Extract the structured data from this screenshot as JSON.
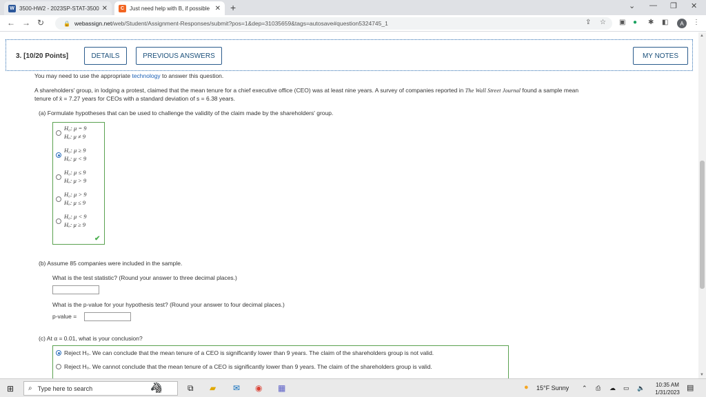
{
  "browser": {
    "tabs": [
      {
        "title": "3500-HW2 - 2023SP-STAT-3500-",
        "favicon": "W",
        "favicon_color": "#2b579a"
      },
      {
        "title": "Just need help with B, if possible",
        "favicon": "C",
        "favicon_color": "#f26522"
      }
    ],
    "url_host": "webassign.net",
    "url_path": "/web/Student/Assignment-Responses/submit?pos=1&dep=31035659&tags=autosave#question5324745_1",
    "avatar_letter": "A"
  },
  "question": {
    "number_label": "3. [10/20 Points]",
    "details_btn": "DETAILS",
    "previous_btn": "PREVIOUS ANSWERS",
    "notes_btn": "MY NOTES",
    "tech_note_pre": "You may need to use the appropriate ",
    "tech_note_link": "technology",
    "tech_note_post": " to answer this question.",
    "problem_line1_a": "A shareholders' group, in lodging a protest, claimed that the mean tenure for a chief executive office (CEO) was at least nine years. A survey of companies reported in ",
    "problem_line1_journal": "The Wall Street Journal",
    "problem_line1_b": " found a sample mean",
    "problem_line2": "tenure of x̄ = 7.27 years for CEOs with a standard deviation of s = 6.38 years.",
    "part_a": "(a)   Formulate hypotheses that can be used to challenge the validity of the claim made by the shareholders' group.",
    "options_a": [
      {
        "h0": "H₀: μ = 9",
        "ha": "Hₐ: μ ≠ 9",
        "selected": false
      },
      {
        "h0": "H₀: μ ≥ 9",
        "ha": "Hₐ: μ < 9",
        "selected": true
      },
      {
        "h0": "H₀: μ ≤ 9",
        "ha": "Hₐ: μ > 9",
        "selected": false
      },
      {
        "h0": "H₀: μ > 9",
        "ha": "Hₐ: μ ≤ 9",
        "selected": false
      },
      {
        "h0": "H₀: μ < 9",
        "ha": "Hₐ: μ ≥ 9",
        "selected": false
      }
    ],
    "part_b": "(b)   Assume 85 companies were included in the sample.",
    "test_stat_q": "What is the test statistic? (Round your answer to three decimal places.)",
    "pvalue_q": "What is the p-value for your hypothesis test? (Round your answer to four decimal places.)",
    "pvalue_label": "p-value =",
    "part_c": "(c)   At α = 0.01, what is your conclusion?",
    "options_c": [
      {
        "text": "Reject H₀. We can conclude that the mean tenure of a CEO is significantly lower than 9 years. The claim of the shareholders group is not valid.",
        "selected": true
      },
      {
        "text": "Reject H₀. We cannot conclude that the mean tenure of a CEO is significantly lower than 9 years. The claim of the shareholders group is valid.",
        "selected": false
      }
    ]
  },
  "taskbar": {
    "search_placeholder": "Type here to search",
    "weather": "15°F  Sunny",
    "time": "10:35 AM",
    "date": "1/31/2023"
  }
}
